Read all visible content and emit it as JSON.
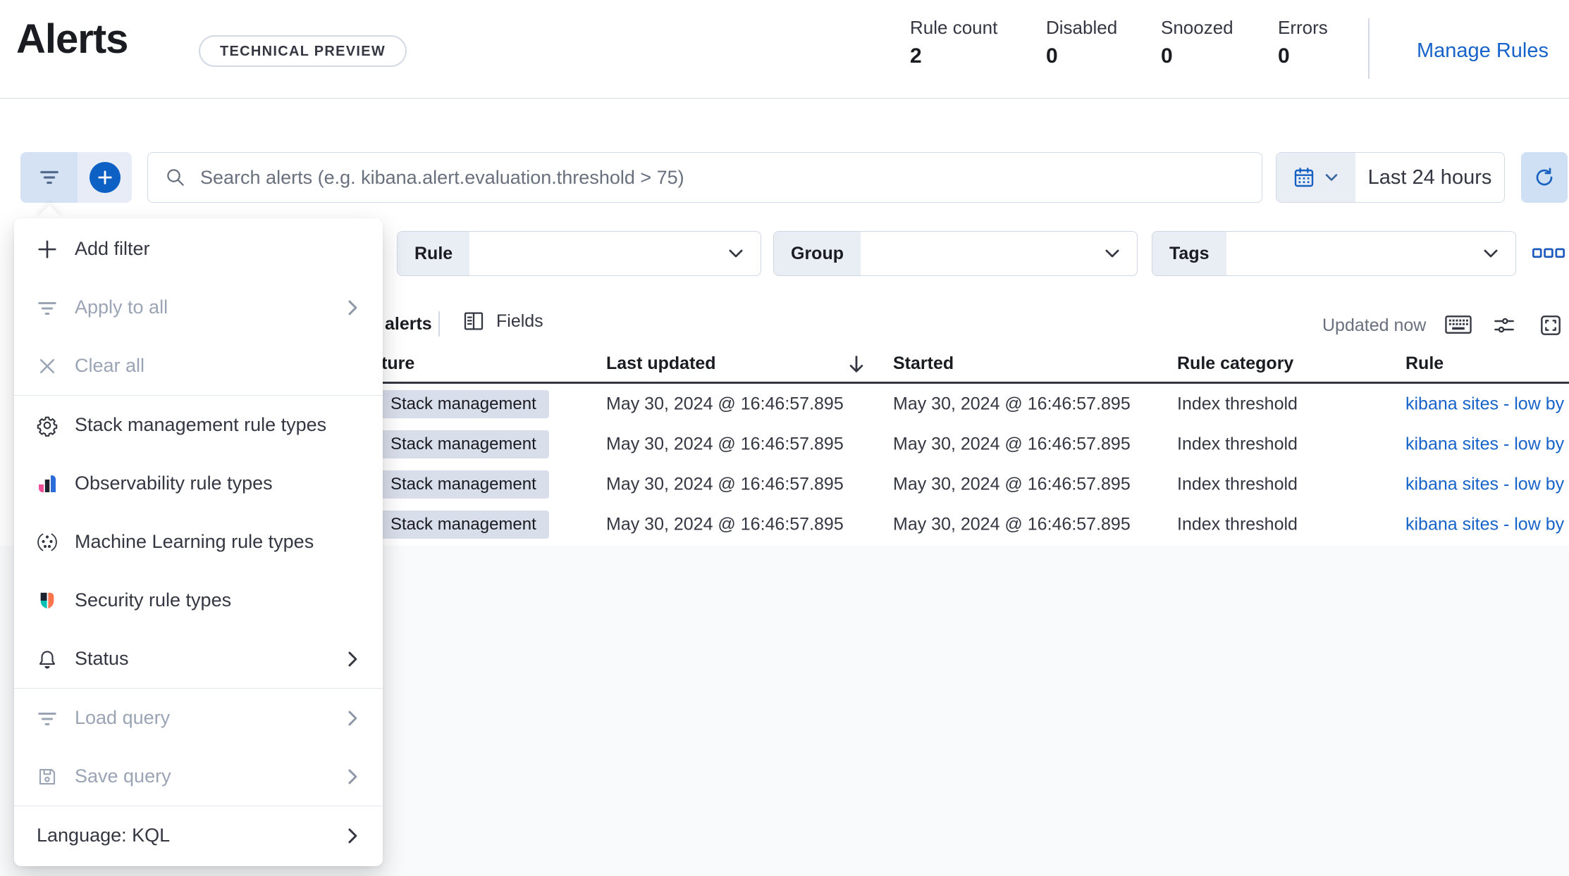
{
  "header": {
    "title": "Alerts",
    "badge": "TECHNICAL PREVIEW",
    "stats": [
      {
        "label": "Rule count",
        "value": "2"
      },
      {
        "label": "Disabled",
        "value": "0"
      },
      {
        "label": "Snoozed",
        "value": "0"
      },
      {
        "label": "Errors",
        "value": "0"
      }
    ],
    "manage_rules_label": "Manage Rules"
  },
  "search_bar": {
    "placeholder": "Search alerts (e.g. kibana.alert.evaluation.threshold > 75)",
    "time_range": "Last 24 hours",
    "icons": [
      "filter-icon",
      "add-filter-plus-icon",
      "search-icon",
      "calendar-icon",
      "refresh-icon"
    ]
  },
  "filter_row": {
    "selects": [
      {
        "label": "Rule",
        "value": ""
      },
      {
        "label": "Group",
        "value": ""
      },
      {
        "label": "Tags",
        "value": ""
      }
    ],
    "more_icon": "boxes-horizontal-icon"
  },
  "filter_menu": {
    "sections": [
      {
        "items": [
          {
            "label": "Add filter",
            "icon": "plus-icon",
            "disabled": false,
            "chevron": false
          },
          {
            "label": "Apply to all",
            "icon": "filter-icon",
            "disabled": true,
            "chevron": true
          },
          {
            "label": "Clear all",
            "icon": "cross-icon",
            "disabled": true,
            "chevron": false
          }
        ]
      },
      {
        "items": [
          {
            "label": "Stack management rule types",
            "icon": "gear-icon",
            "disabled": false,
            "chevron": false
          },
          {
            "label": "Observability rule types",
            "icon": "observability-icon",
            "disabled": false,
            "chevron": false
          },
          {
            "label": "Machine Learning rule types",
            "icon": "machine-learning-icon",
            "disabled": false,
            "chevron": false
          },
          {
            "label": "Security rule types",
            "icon": "security-icon",
            "disabled": false,
            "chevron": false
          },
          {
            "label": "Status",
            "icon": "bell-icon",
            "disabled": false,
            "chevron": true
          }
        ]
      },
      {
        "items": [
          {
            "label": "Load query",
            "icon": "filter-icon",
            "disabled": true,
            "chevron": true
          },
          {
            "label": "Save query",
            "icon": "save-icon",
            "disabled": true,
            "chevron": true
          }
        ]
      },
      {
        "items": [
          {
            "label": "Language: KQL",
            "icon": null,
            "disabled": false,
            "chevron": true
          }
        ]
      }
    ]
  },
  "toolbar": {
    "alerts_count_label": "alerts",
    "fields_label": "Fields",
    "updated_label": "Updated now",
    "icons": [
      "keyboard-icon",
      "controls-icon",
      "fullscreen-icon"
    ]
  },
  "table": {
    "columns": [
      "Feature",
      "Last updated",
      "Started",
      "Rule category",
      "Rule"
    ],
    "sorted_column": "Last updated",
    "rows": [
      {
        "feature": "Stack management",
        "last_updated": "May 30, 2024 @ 16:46:57.895",
        "started": "May 30, 2024 @ 16:46:57.895",
        "rule_category": "Index threshold",
        "rule": "kibana sites - low by"
      },
      {
        "feature": "Stack management",
        "last_updated": "May 30, 2024 @ 16:46:57.895",
        "started": "May 30, 2024 @ 16:46:57.895",
        "rule_category": "Index threshold",
        "rule": "kibana sites - low by"
      },
      {
        "feature": "Stack management",
        "last_updated": "May 30, 2024 @ 16:46:57.895",
        "started": "May 30, 2024 @ 16:46:57.895",
        "rule_category": "Index threshold",
        "rule": "kibana sites - low by"
      },
      {
        "feature": "Stack management",
        "last_updated": "May 30, 2024 @ 16:46:57.895",
        "started": "May 30, 2024 @ 16:46:57.895",
        "rule_category": "Index threshold",
        "rule": "kibana sites - low by"
      }
    ]
  },
  "colors": {
    "accent_blue": "#155fc2",
    "link_blue": "#1763c9",
    "badge_bg": "#d9deeb",
    "header_border": "#343741",
    "panel_gray": "#e9edf4",
    "observability_pink": "#f04e98",
    "observability_blue": "#2b6cd9",
    "security_teal": "#00bfb3",
    "security_orange": "#fa744e"
  }
}
